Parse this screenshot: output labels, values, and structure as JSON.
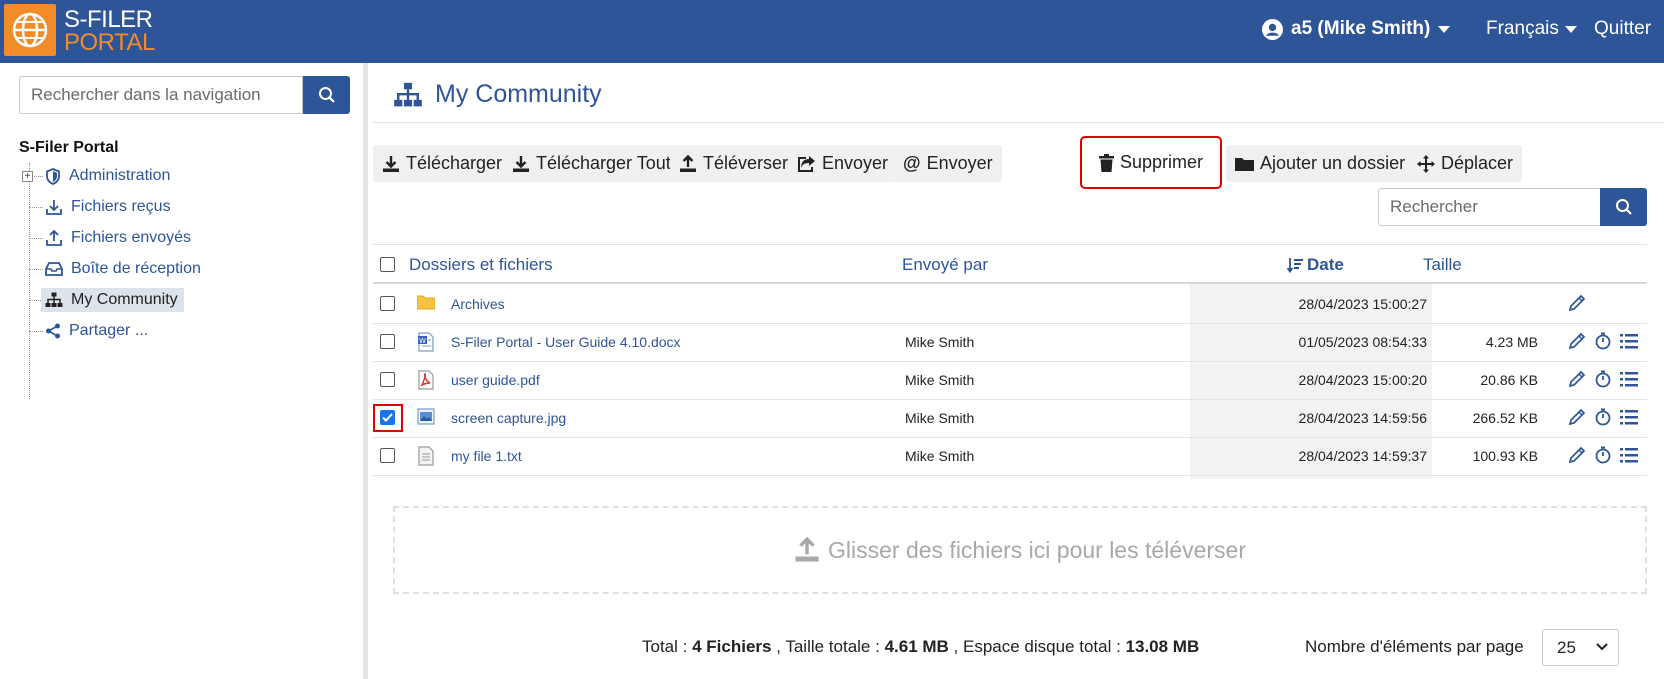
{
  "header": {
    "logo_line1": "S-FILER",
    "logo_line2": "PORTAL",
    "user_label": "a5 (Mike Smith)",
    "language": "Français",
    "quit": "Quitter",
    "bg_color": "#2e5597",
    "accent_color": "#f28c28"
  },
  "sidebar": {
    "search_placeholder": "Rechercher dans la navigation",
    "root_label": "S-Filer Portal",
    "items": [
      {
        "label": "Administration",
        "icon": "shield-icon"
      },
      {
        "label": "Fichiers reçus",
        "icon": "inbox-download-icon"
      },
      {
        "label": "Fichiers envoyés",
        "icon": "inbox-upload-icon"
      },
      {
        "label": "Boîte de réception",
        "icon": "inbox-icon"
      },
      {
        "label": "My Community",
        "icon": "sitemap-icon",
        "active": true
      },
      {
        "label": "Partager ...",
        "icon": "share-icon"
      }
    ]
  },
  "page": {
    "title": "My Community"
  },
  "toolbar": {
    "download": "Télécharger",
    "download_all": "Télécharger Tout",
    "upload": "Téléverser",
    "send": "Envoyer",
    "send_email": "Envoyer",
    "delete": "Supprimer",
    "add_folder": "Ajouter un dossier",
    "move": "Déplacer"
  },
  "search": {
    "placeholder": "Rechercher"
  },
  "table": {
    "headers": {
      "name": "Dossiers et fichiers",
      "sent_by": "Envoyé par",
      "date": "Date",
      "size": "Taille"
    },
    "rows": [
      {
        "type": "folder-icon",
        "name": "Archives",
        "sent_by": "",
        "date": "28/04/2023 15:00:27",
        "size": "",
        "checked": false
      },
      {
        "type": "word-file-icon",
        "name": "S-Filer Portal - User Guide 4.10.docx",
        "sent_by": "Mike Smith",
        "date": "01/05/2023 08:54:33",
        "size": "4.23 MB",
        "checked": false
      },
      {
        "type": "pdf-file-icon",
        "name": "user guide.pdf",
        "sent_by": "Mike Smith",
        "date": "28/04/2023 15:00:20",
        "size": "20.86 KB",
        "checked": false
      },
      {
        "type": "image-file-icon",
        "name": "screen capture.jpg",
        "sent_by": "Mike Smith",
        "date": "28/04/2023 14:59:56",
        "size": "266.52 KB",
        "checked": true
      },
      {
        "type": "text-file-icon",
        "name": "my file 1.txt",
        "sent_by": "Mike Smith",
        "date": "28/04/2023 14:59:37",
        "size": "100.93 KB",
        "checked": false
      }
    ]
  },
  "dropzone": {
    "text": "Glisser des fichiers ici pour les téléverser"
  },
  "footer": {
    "total_label": "Total : ",
    "total_value": "4 Fichiers",
    "size_label": " , Taille totale : ",
    "size_value": "4.61 MB",
    "disk_label": " , Espace disque total : ",
    "disk_value": "13.08 MB",
    "per_page_label": "Nombre d'éléments par page",
    "per_page_value": "25"
  }
}
